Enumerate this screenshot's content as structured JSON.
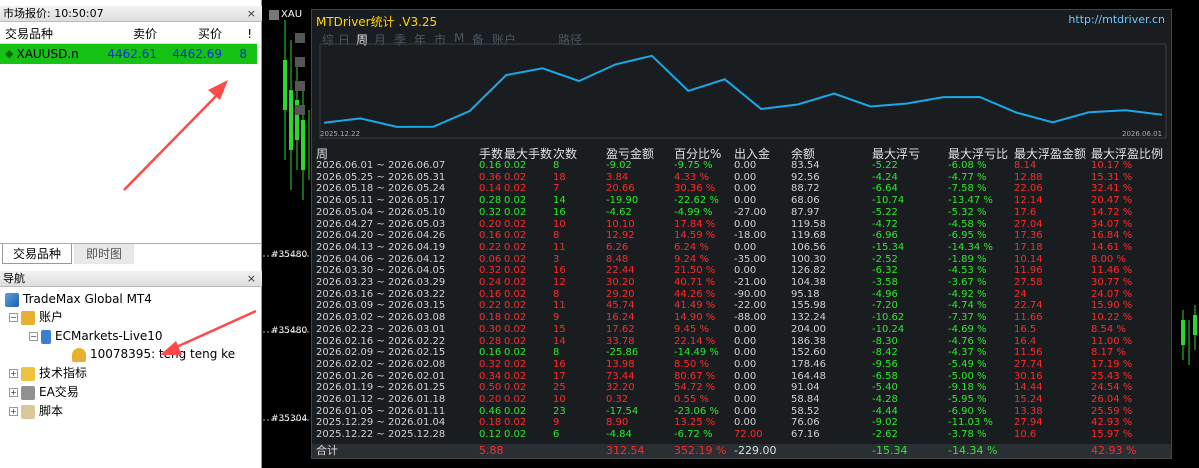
{
  "market": {
    "title": "市场报价: 10:50:07",
    "close": "×",
    "headers": [
      "交易品种",
      "卖价",
      "买价",
      "!"
    ],
    "row": {
      "symbol": "XAUUSD.n",
      "bid": "4462.61",
      "ask": "4462.69",
      "spread": "8"
    }
  },
  "tabs": [
    "交易品种",
    "即时图"
  ],
  "nav": {
    "title": "导航",
    "close": "×",
    "items": [
      "TradeMax Global MT4",
      "账户",
      "ECMarkets-Live10",
      "10078395: teng teng ke",
      "技术指标",
      "EA交易",
      "脚本"
    ]
  },
  "chart": {
    "symbol": "XAU",
    "price_labels": [
      "#35480",
      "#35480",
      "#35304"
    ]
  },
  "mtd": {
    "title": "MTDriver统计 .V3.25",
    "url": "http://mtdriver.cn",
    "periods": [
      "综",
      "日",
      "周",
      "月",
      "季",
      "年",
      "市",
      "M",
      "备",
      "账户",
      "路径"
    ],
    "active_period": "周",
    "curve": {
      "start_label": "2025.12.22",
      "end_label": "2026.06.01",
      "balance": [
        67.16,
        76.06,
        58.52,
        58.84,
        91.04,
        164.48,
        178.46,
        152.6,
        186.38,
        204.0,
        132.24,
        155.98,
        95.18,
        104.38,
        126.82,
        100.3,
        106.56,
        119.58,
        119.68,
        87.97,
        68.06,
        88.72,
        92.56,
        83.54
      ]
    },
    "headers": [
      "周",
      "手数",
      "最大手数",
      "次数",
      "盈亏金额",
      "百分比%",
      "出入金",
      "余额",
      "最大浮亏",
      "最大浮亏比",
      "最大浮盈金额",
      "最大浮盈比例"
    ],
    "rows": [
      [
        "2026.06.01 ~ 2026.06.07",
        "0.16",
        "0.02",
        "8",
        "-9.02",
        "-9.75 %",
        "0.00",
        "83.54",
        "-5.22",
        "-6.08 %",
        "8.14",
        "10.17 %"
      ],
      [
        "2026.05.25 ~ 2026.05.31",
        "0.36",
        "0.02",
        "18",
        "3.84",
        "4.33 %",
        "0.00",
        "92.56",
        "-4.24",
        "-4.77 %",
        "12.88",
        "15.31 %"
      ],
      [
        "2026.05.18 ~ 2026.05.24",
        "0.14",
        "0.02",
        "7",
        "20.66",
        "30.36 %",
        "0.00",
        "88.72",
        "-6.64",
        "-7.58 %",
        "22.06",
        "32.41 %"
      ],
      [
        "2026.05.11 ~ 2026.05.17",
        "0.28",
        "0.02",
        "14",
        "-19.90",
        "-22.62 %",
        "0.00",
        "68.06",
        "-10.74",
        "-13.47 %",
        "12.14",
        "20.47 %"
      ],
      [
        "2026.05.04 ~ 2026.05.10",
        "0.32",
        "0.02",
        "16",
        "-4.62",
        "-4.99 %",
        "-27.00",
        "87.97",
        "-5.22",
        "-5.32 %",
        "17.6",
        "14.72 %"
      ],
      [
        "2026.04.27 ~ 2026.05.03",
        "0.20",
        "0.02",
        "10",
        "10.10",
        "17.84 %",
        "0.00",
        "119.58",
        "-4.72",
        "-4.58 %",
        "27.04",
        "34.07 %"
      ],
      [
        "2026.04.20 ~ 2026.04.26",
        "0.16",
        "0.02",
        "8",
        "12.92",
        "14.59 %",
        "-18.00",
        "119.68",
        "-6.96",
        "-6.95 %",
        "17.36",
        "16.84 %"
      ],
      [
        "2026.04.13 ~ 2026.04.19",
        "0.22",
        "0.02",
        "11",
        "6.26",
        "6.24 %",
        "0.00",
        "106.56",
        "-15.34",
        "-14.34 %",
        "17.18",
        "14.61 %"
      ],
      [
        "2026.04.06 ~ 2026.04.12",
        "0.06",
        "0.02",
        "3",
        "8.48",
        "9.24 %",
        "-35.00",
        "100.30",
        "-2.52",
        "-1.89 %",
        "10.14",
        "8.00 %"
      ],
      [
        "2026.03.30 ~ 2026.04.05",
        "0.32",
        "0.02",
        "16",
        "22.44",
        "21.50 %",
        "0.00",
        "126.82",
        "-6.32",
        "-4.53 %",
        "11.96",
        "11.46 %"
      ],
      [
        "2026.03.23 ~ 2026.03.29",
        "0.24",
        "0.02",
        "12",
        "30.20",
        "40.71 %",
        "-21.00",
        "104.38",
        "-3.58",
        "-3.67 %",
        "27.58",
        "30.77 %"
      ],
      [
        "2026.03.16 ~ 2026.03.22",
        "0.16",
        "0.02",
        "8",
        "29.20",
        "44.26 %",
        "-90.00",
        "95.18",
        "-4.96",
        "-4.92 %",
        "24",
        "24.07 %"
      ],
      [
        "2026.03.09 ~ 2026.03.15",
        "0.22",
        "0.02",
        "11",
        "45.74",
        "41.49 %",
        "-22.00",
        "155.98",
        "-7.20",
        "-4.74 %",
        "22.74",
        "15.90 %"
      ],
      [
        "2026.03.02 ~ 2026.03.08",
        "0.18",
        "0.02",
        "9",
        "16.24",
        "14.90 %",
        "-88.00",
        "132.24",
        "-10.62",
        "-7.37 %",
        "11.66",
        "10.22 %"
      ],
      [
        "2026.02.23 ~ 2026.03.01",
        "0.30",
        "0.02",
        "15",
        "17.62",
        "9.45 %",
        "0.00",
        "204.00",
        "-10.24",
        "-4.69 %",
        "16.5",
        "8.54 %"
      ],
      [
        "2026.02.16 ~ 2026.02.22",
        "0.28",
        "0.02",
        "14",
        "33.78",
        "22.14 %",
        "0.00",
        "186.38",
        "-8.30",
        "-4.76 %",
        "16.4",
        "11.00 %"
      ],
      [
        "2026.02.09 ~ 2026.02.15",
        "0.16",
        "0.02",
        "8",
        "-25.86",
        "-14.49 %",
        "0.00",
        "152.60",
        "-8.42",
        "-4.37 %",
        "11.56",
        "8.17 %"
      ],
      [
        "2026.02.02 ~ 2026.02.08",
        "0.32",
        "0.02",
        "16",
        "13.98",
        "8.50 %",
        "0.00",
        "178.46",
        "-9.56",
        "-5.49 %",
        "27.74",
        "17.19 %"
      ],
      [
        "2026.01.26 ~ 2026.02.01",
        "0.34",
        "0.02",
        "17",
        "73.44",
        "80.67 %",
        "0.00",
        "164.48",
        "-6.58",
        "-5.00 %",
        "30.16",
        "25.43 %"
      ],
      [
        "2026.01.19 ~ 2026.01.25",
        "0.50",
        "0.02",
        "25",
        "32.20",
        "54.72 %",
        "0.00",
        "91.04",
        "-5.40",
        "-9.18 %",
        "14.44",
        "24.54 %"
      ],
      [
        "2026.01.12 ~ 2026.01.18",
        "0.20",
        "0.02",
        "10",
        "0.32",
        "0.55 %",
        "0.00",
        "58.84",
        "-4.28",
        "-5.95 %",
        "15.24",
        "26.04 %"
      ],
      [
        "2026.01.05 ~ 2026.01.11",
        "0.46",
        "0.02",
        "23",
        "-17.54",
        "-23.06 %",
        "0.00",
        "58.52",
        "-4.44",
        "-6.90 %",
        "13.38",
        "25.59 %"
      ],
      [
        "2025.12.29 ~ 2026.01.04",
        "0.18",
        "0.02",
        "9",
        "8.90",
        "13.25 %",
        "0.00",
        "76.06",
        "-9.02",
        "-11.03 %",
        "27.94",
        "42.93 %"
      ],
      [
        "2025.12.22 ~ 2025.12.28",
        "0.12",
        "0.02",
        "6",
        "-4.84",
        "-6.72 %",
        "72.00",
        "67.16",
        "-2.62",
        "-3.78 %",
        "10.6",
        "15.97 %"
      ]
    ],
    "footer": [
      "合计",
      "5.88",
      "",
      "",
      "312.54",
      "352.19 %",
      "-229.00",
      "",
      "-15.34",
      "-14.34 %",
      "",
      "42.93 %"
    ]
  }
}
